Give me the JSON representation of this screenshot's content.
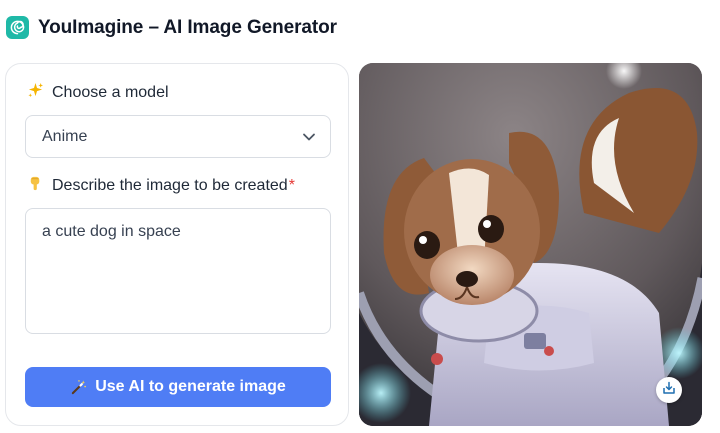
{
  "header": {
    "title": "YouImagine – AI Image Generator",
    "logo_icon": "spiral-logo-icon",
    "accent": "#1fb9a7"
  },
  "form": {
    "model_label": "Choose a model",
    "model_label_icon": "sparkles-icon",
    "model_value": "Anime",
    "description_label": "Describe the image to be created",
    "description_label_icon": "pointing-down-hand-icon",
    "required_marker": "*",
    "description_value": "a cute dog in space",
    "generate_button": "Use AI to generate image",
    "generate_button_icon": "magic-wand-icon",
    "button_color": "#4f7df5"
  },
  "result": {
    "image_description_icon": "generated-image",
    "download_icon": "download-icon"
  }
}
